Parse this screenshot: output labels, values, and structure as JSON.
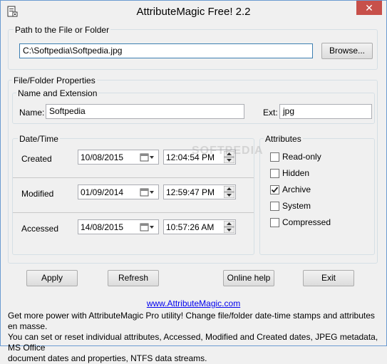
{
  "window": {
    "title": "AttributeMagic Free! 2.2",
    "close": "✕"
  },
  "path_group": {
    "title": "Path to the File or Folder",
    "path_value": "C:\\Softpedia\\Softpedia.jpg",
    "browse_label": "Browse..."
  },
  "properties": {
    "title": "File/Folder Properties"
  },
  "name_group": {
    "title": "Name and Extension",
    "name_label": "Name:",
    "name_value": "Softpedia",
    "ext_label": "Ext:",
    "ext_value": "jpg"
  },
  "datetime": {
    "title": "Date/Time",
    "rows": [
      {
        "label": "Created",
        "date": "10/08/2015",
        "time": "12:04:54 PM"
      },
      {
        "label": "Modified",
        "date": "01/09/2014",
        "time": "12:59:47 PM"
      },
      {
        "label": "Accessed",
        "date": "14/08/2015",
        "time": "10:57:26 AM"
      }
    ]
  },
  "attributes": {
    "title": "Attributes",
    "items": [
      {
        "label": "Read-only",
        "checked": false
      },
      {
        "label": "Hidden",
        "checked": false
      },
      {
        "label": "Archive",
        "checked": true
      },
      {
        "label": "System",
        "checked": false
      },
      {
        "label": "Compressed",
        "checked": false
      }
    ]
  },
  "buttons": {
    "apply": "Apply",
    "refresh": "Refresh",
    "online_help": "Online help",
    "exit": "Exit"
  },
  "watermark": "SOFTPEDIA",
  "footer": {
    "link": "www.AttributeMagic.com",
    "line1": "Get more power with AttributeMagic Pro utility! Change file/folder date-time stamps and attributes en masse.",
    "line2": "You can set or reset individual attributes, Accessed, Modified and Created dates, JPEG metadata, MS Office",
    "line3": "document dates and properties, NTFS data streams."
  },
  "colors": {
    "accent": "#3c7fb1",
    "close_bg": "#c7504a",
    "link": "#0000ee"
  }
}
